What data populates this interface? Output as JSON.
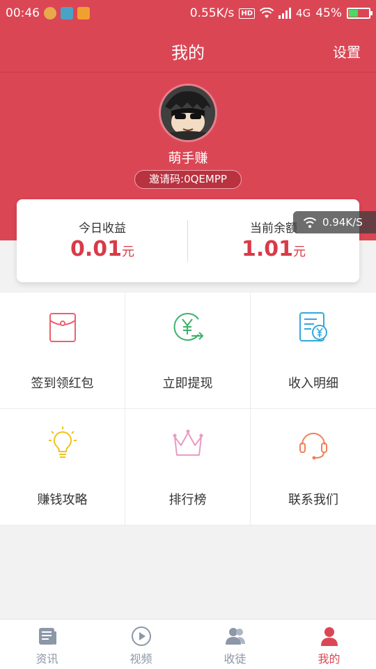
{
  "status_bar": {
    "time": "00:46",
    "network_speed": "0.55K/s",
    "hd": "HD",
    "signal_type": "4G",
    "battery": "45%",
    "battery_level": 0.45
  },
  "header": {
    "title": "我的",
    "settings_label": "设置"
  },
  "profile": {
    "username": "萌手赚",
    "invite_code": "邀请码:0QEMPP"
  },
  "earnings": {
    "today_label": "今日收益",
    "today_value": "0.01",
    "balance_label": "当前余额",
    "balance_value": "1.01",
    "unit": "元"
  },
  "speed_overlay": {
    "value": "0.94K/S"
  },
  "grid_items": [
    {
      "label": "签到领红包",
      "icon": "red-envelope-icon",
      "color": "#e9626e"
    },
    {
      "label": "立即提现",
      "icon": "withdraw-icon",
      "color": "#3bb16a"
    },
    {
      "label": "收入明细",
      "icon": "income-detail-icon",
      "color": "#33a7dc"
    },
    {
      "label": "赚钱攻略",
      "icon": "lightbulb-icon",
      "color": "#f2c21a"
    },
    {
      "label": "排行榜",
      "icon": "crown-icon",
      "color": "#eb9ac3"
    },
    {
      "label": "联系我们",
      "icon": "headset-icon",
      "color": "#ef8158"
    }
  ],
  "tabs": [
    {
      "label": "资讯",
      "icon": "news-icon",
      "active": false
    },
    {
      "label": "视频",
      "icon": "video-icon",
      "active": false
    },
    {
      "label": "收徒",
      "icon": "apprentice-icon",
      "active": false
    },
    {
      "label": "我的",
      "icon": "profile-icon",
      "active": true
    }
  ],
  "colors": {
    "brand": "#db4655",
    "amount": "#d93a48",
    "tab_inactive": "#8c97a8"
  }
}
